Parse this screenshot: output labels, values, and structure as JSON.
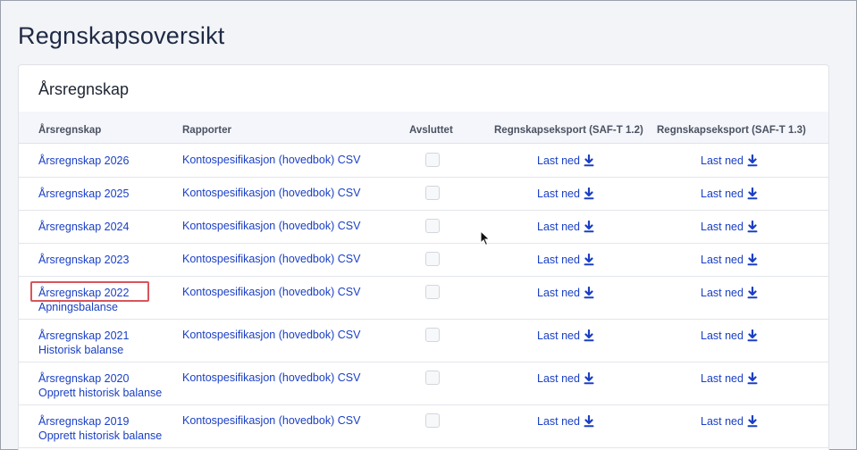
{
  "page": {
    "title": "Regnskapsoversikt"
  },
  "card": {
    "title": "Årsregnskap"
  },
  "table": {
    "headers": {
      "year": "Årsregnskap",
      "reports": "Rapporter",
      "closed": "Avsluttet",
      "export12": "Regnskapseksport (SAF-T 1.2)",
      "export13": "Regnskapseksport (SAF-T 1.3)"
    },
    "rows": [
      {
        "year": "Årsregnskap 2026",
        "sub": "",
        "report": "Kontospesifikasjon (hovedbok) CSV",
        "dl1": "Last ned",
        "dl2": "Last ned"
      },
      {
        "year": "Årsregnskap 2025",
        "sub": "",
        "report": "Kontospesifikasjon (hovedbok) CSV",
        "dl1": "Last ned",
        "dl2": "Last ned"
      },
      {
        "year": "Årsregnskap 2024",
        "sub": "",
        "report": "Kontospesifikasjon (hovedbok) CSV",
        "dl1": "Last ned",
        "dl2": "Last ned"
      },
      {
        "year": "Årsregnskap 2023",
        "sub": "",
        "report": "Kontospesifikasjon (hovedbok) CSV",
        "dl1": "Last ned",
        "dl2": "Last ned"
      },
      {
        "year": "Årsregnskap 2022",
        "sub": "Apningsbalanse",
        "report": "Kontospesifikasjon (hovedbok) CSV",
        "dl1": "Last ned",
        "dl2": "Last ned"
      },
      {
        "year": "Årsregnskap 2021",
        "sub": "Historisk balanse",
        "report": "Kontospesifikasjon (hovedbok) CSV",
        "dl1": "Last ned",
        "dl2": "Last ned"
      },
      {
        "year": "Årsregnskap 2020",
        "sub": "Opprett historisk balanse",
        "report": "Kontospesifikasjon (hovedbok) CSV",
        "dl1": "Last ned",
        "dl2": "Last ned"
      },
      {
        "year": "Årsregnskap 2019",
        "sub": "Opprett historisk balanse",
        "report": "Kontospesifikasjon (hovedbok) CSV",
        "dl1": "Last ned",
        "dl2": "Last ned"
      }
    ]
  },
  "icons": {
    "download": "download-arrow-icon",
    "cursor": "mouse-pointer-icon"
  },
  "colors": {
    "link": "#1a3fc4",
    "highlight": "#d9545b",
    "header_bg": "#f4f6fb"
  }
}
